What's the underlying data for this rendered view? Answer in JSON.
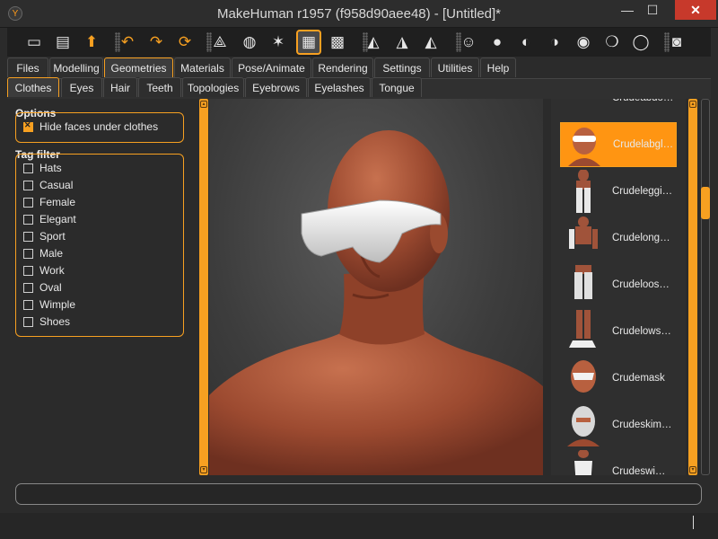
{
  "window": {
    "title": "MakeHuman r1957 (f958d90aee48) - [Untitled]*",
    "minimize": "—",
    "maximize": "☐",
    "close": "✕"
  },
  "toolbar": [
    {
      "name": "new-button",
      "icon": "new-file-icon",
      "glyph": "▭"
    },
    {
      "name": "save-button",
      "icon": "save-icon",
      "glyph": "▤"
    },
    {
      "name": "export-button",
      "icon": "export-icon",
      "glyph": "⬆"
    },
    {
      "name": "undo-button",
      "icon": "undo-icon",
      "glyph": "↶"
    },
    {
      "name": "redo-button",
      "icon": "redo-icon",
      "glyph": "↷"
    },
    {
      "name": "reset-button",
      "icon": "reset-icon",
      "glyph": "⟳"
    },
    {
      "name": "smooth-button",
      "icon": "smooth-icon",
      "glyph": "⟁"
    },
    {
      "name": "wireframe-button",
      "icon": "wireframe-icon",
      "glyph": "◍"
    },
    {
      "name": "pose-button",
      "icon": "pose-icon",
      "glyph": "✶"
    },
    {
      "name": "grid-button",
      "icon": "grid-icon",
      "glyph": "▦"
    },
    {
      "name": "background-button",
      "icon": "checker-icon",
      "glyph": "▩"
    },
    {
      "name": "view-front-button",
      "icon": "front-view-icon",
      "glyph": "◭"
    },
    {
      "name": "view-back-button",
      "icon": "back-view-icon",
      "glyph": "◮"
    },
    {
      "name": "view-side-button",
      "icon": "side-view-icon",
      "glyph": "◭"
    },
    {
      "name": "face-front-button",
      "icon": "face-front-icon",
      "glyph": "☺"
    },
    {
      "name": "face-back-button",
      "icon": "head-back-icon",
      "glyph": "●"
    },
    {
      "name": "face-left-button",
      "icon": "head-left-icon",
      "glyph": "◐"
    },
    {
      "name": "face-right-button",
      "icon": "head-right-icon",
      "glyph": "◑"
    },
    {
      "name": "head-top-button",
      "icon": "head-top-icon",
      "glyph": "◉"
    },
    {
      "name": "head-bottom-button",
      "icon": "head-bottom-icon",
      "glyph": "❍"
    },
    {
      "name": "global-camera-button",
      "icon": "camera-frame-icon",
      "glyph": "◯"
    },
    {
      "name": "screenshot-button",
      "icon": "camera-icon",
      "glyph": "◙"
    }
  ],
  "main_tabs": [
    "Files",
    "Modelling",
    "Geometries",
    "Materials",
    "Pose/Animate",
    "Rendering",
    "Settings",
    "Utilities",
    "Help"
  ],
  "main_tab_active": "Geometries",
  "sub_tabs": [
    "Clothes",
    "Eyes",
    "Hair",
    "Teeth",
    "Topologies",
    "Eyebrows",
    "Eyelashes",
    "Tongue"
  ],
  "sub_tab_active": "Clothes",
  "options": {
    "title": "Options",
    "hide_faces_label": "Hide faces under clothes",
    "hide_faces_checked": true
  },
  "tag_filter": {
    "title": "Tag filter",
    "tags": [
      "Hats",
      "Casual",
      "Female",
      "Elegant",
      "Sport",
      "Male",
      "Work",
      "Oval",
      "Wimple",
      "Shoes"
    ]
  },
  "clothes_list": [
    {
      "label": "Crudeabdo…",
      "selected": false
    },
    {
      "label": "Crudelabgl…",
      "selected": true
    },
    {
      "label": "Crudeleggi…",
      "selected": false
    },
    {
      "label": "Crudelong…",
      "selected": false
    },
    {
      "label": "Crudeloos…",
      "selected": false
    },
    {
      "label": "Crudelows…",
      "selected": false
    },
    {
      "label": "Crudemask",
      "selected": false
    },
    {
      "label": "Crudeskim…",
      "selected": false
    },
    {
      "label": "Crudeswi…",
      "selected": false
    }
  ],
  "colors": {
    "accent": "#f7a021",
    "panel": "#2b2b2b",
    "skin": "#a8543a"
  }
}
